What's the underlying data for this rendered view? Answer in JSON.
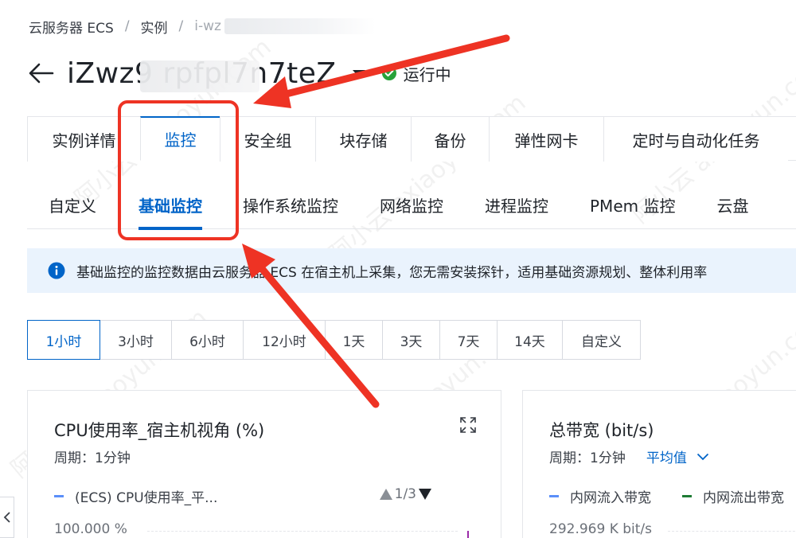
{
  "breadcrumb": {
    "items": [
      "云服务器 ECS",
      "实例",
      "i-wz"
    ],
    "separator": "/"
  },
  "header": {
    "title": "iZwz9            rpfpl7n7teZ",
    "status": "运行中",
    "status_color": "#27a23a"
  },
  "tabs": [
    "实例详情",
    "监控",
    "安全组",
    "块存储",
    "备份",
    "弹性网卡",
    "定时与自动化任务"
  ],
  "active_tab": "监控",
  "subtabs": [
    "自定义",
    "基础监控",
    "操作系统监控",
    "网络监控",
    "进程监控",
    "PMem 监控",
    "云盘"
  ],
  "active_subtab": "基础监控",
  "banner": {
    "text": "基础监控的监控数据由云服务器 ECS 在宿主机上采集，您无需安装探针，适用基础资源规划、整体利用率"
  },
  "time_ranges": [
    "1小时",
    "3小时",
    "6小时",
    "12小时",
    "1天",
    "3天",
    "7天",
    "14天",
    "自定义"
  ],
  "active_time_range": "1小时",
  "cards": [
    {
      "title": "CPU使用率_宿主机视角 (%)",
      "period": "周期：1分钟",
      "legend": [
        {
          "label": "(ECS) CPU使用率_平...",
          "color": "#5b8ff9"
        }
      ],
      "pager": "1/3",
      "axis_top": "100.000 %"
    },
    {
      "title": "总带宽 (bit/s)",
      "period": "周期：1分钟",
      "aggregation": "平均值",
      "legend": [
        {
          "label": "内网流入带宽",
          "color": "#5b8ff9"
        },
        {
          "label": "内网流出带宽",
          "color": "#1e7b34"
        }
      ],
      "axis_top": "292.969 K bit/s"
    }
  ],
  "colors": {
    "accent": "#0064c8",
    "annotation": "#ee3324",
    "banner_bg": "#eaf3fd"
  },
  "watermark": "阿小云 axiaoyun.com"
}
